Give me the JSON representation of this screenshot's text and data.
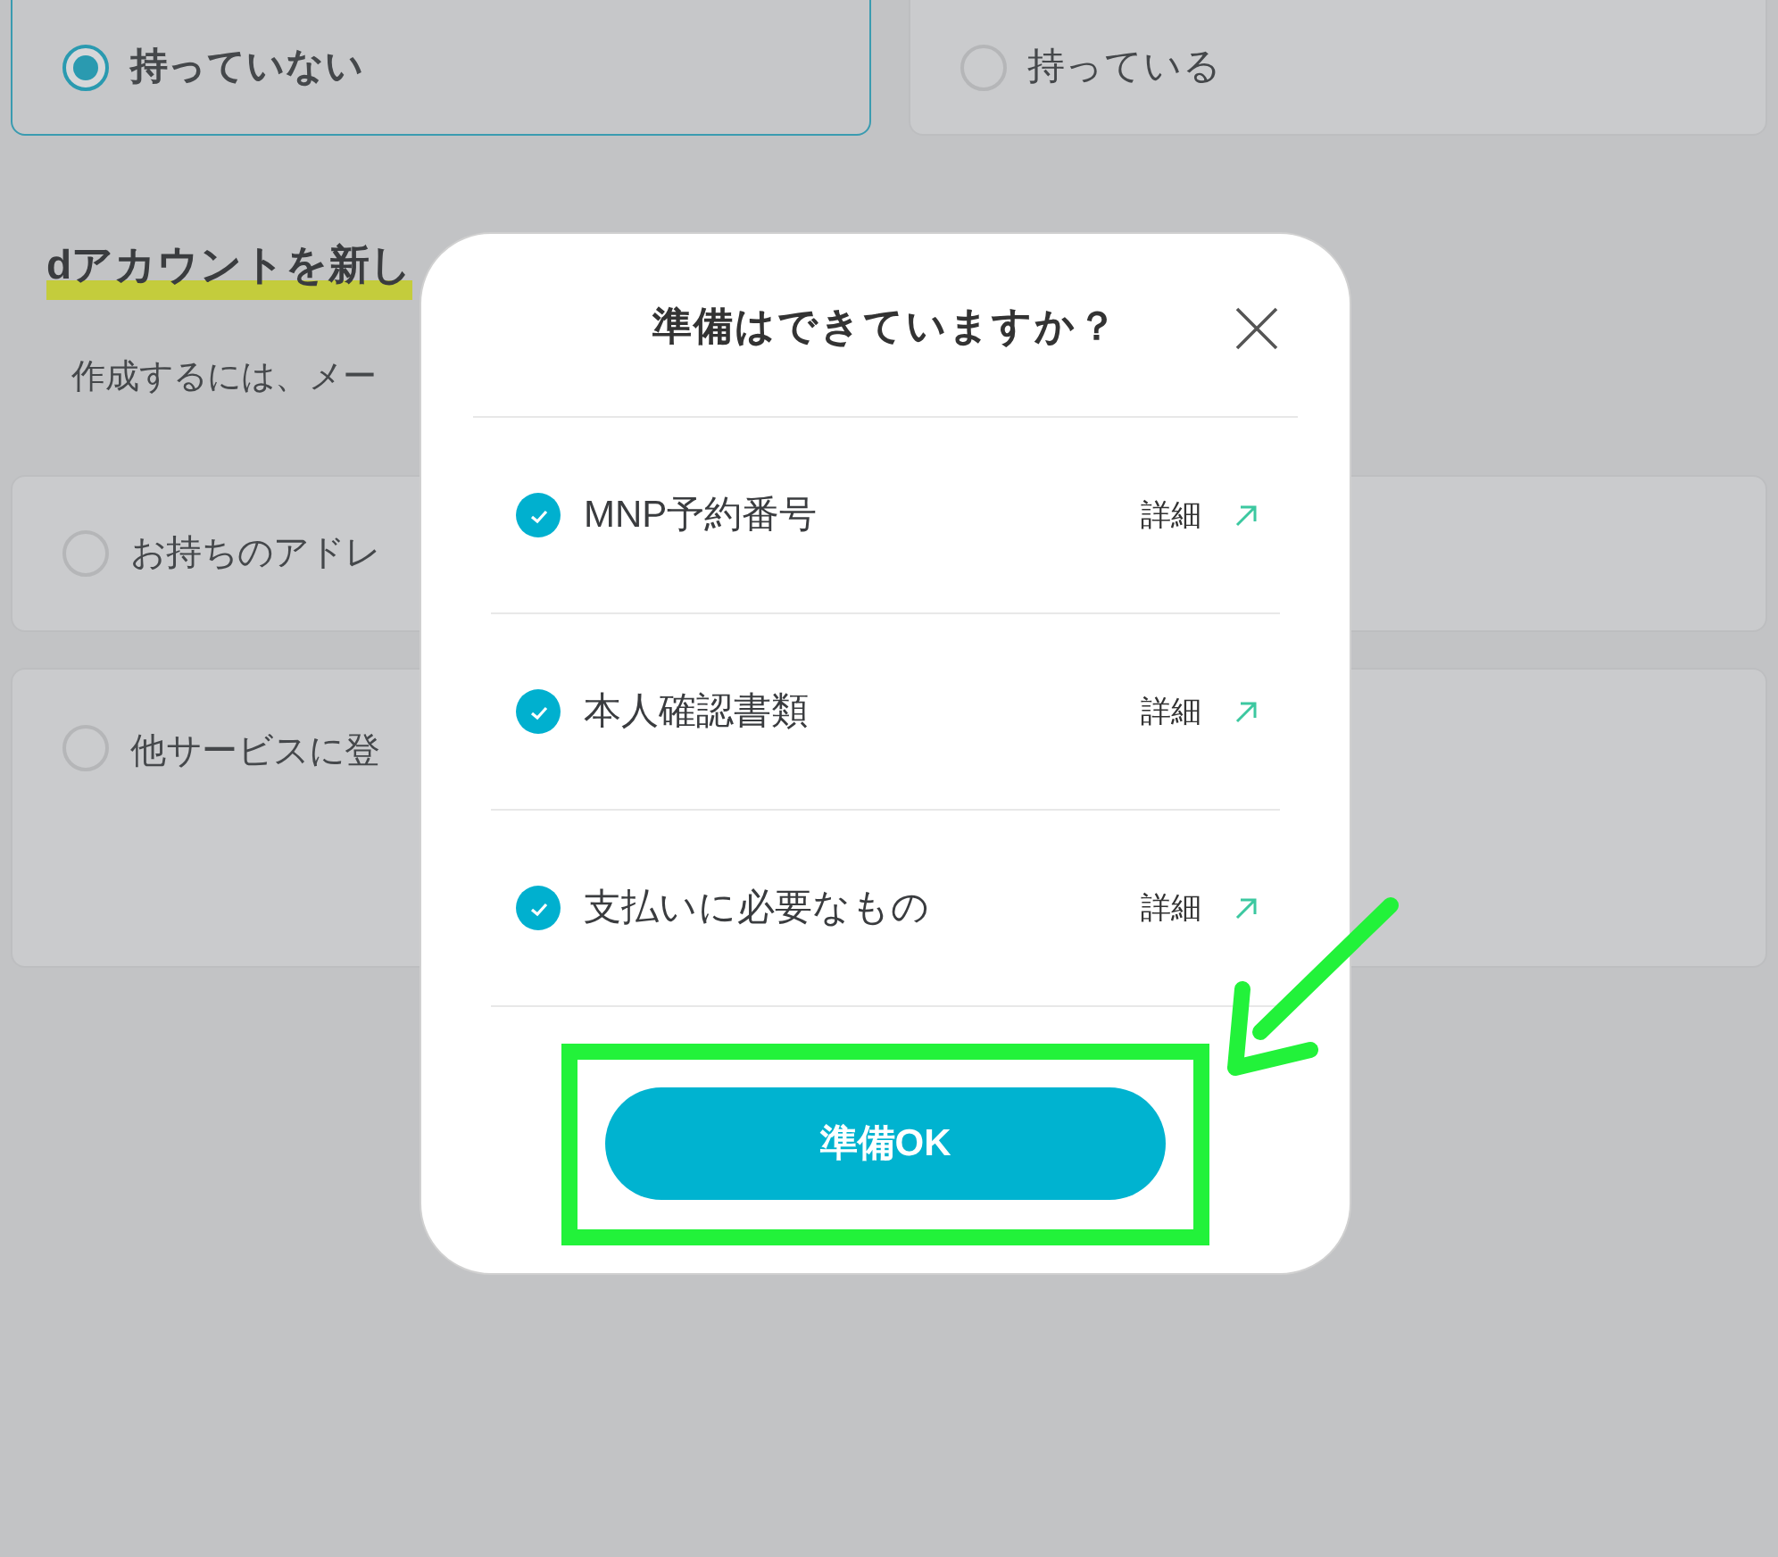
{
  "background": {
    "choices": [
      {
        "label": "持っていない",
        "selected": true
      },
      {
        "label": "持っている",
        "selected": false
      }
    ],
    "heading": "dアカウントを新し",
    "description": "作成するには、メー",
    "options": [
      {
        "label": "お持ちのアドレ",
        "selected": false
      },
      {
        "label": "他サービスに登",
        "selected": false
      }
    ]
  },
  "dialog": {
    "title": "準備はできていますか？",
    "items": [
      {
        "label": "MNP予約番号",
        "checked": true,
        "link": "詳細"
      },
      {
        "label": "本人確認書類",
        "checked": true,
        "link": "詳細"
      },
      {
        "label": "支払いに必要なもの",
        "checked": true,
        "link": "詳細"
      }
    ],
    "button": "準備OK"
  }
}
